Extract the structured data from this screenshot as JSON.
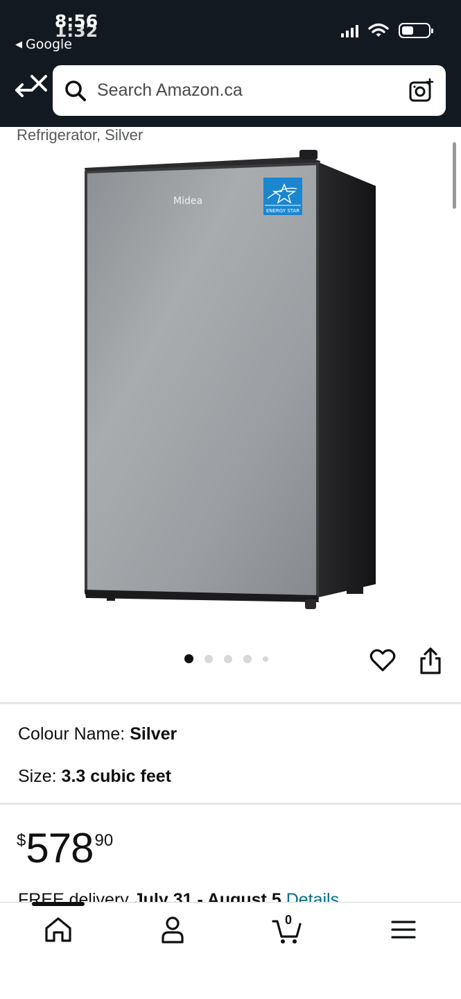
{
  "status_bar": {
    "time_primary": "8:56",
    "time_overlay": "1:32",
    "back_app_label": "Google"
  },
  "search": {
    "placeholder": "Search Amazon.ca"
  },
  "product": {
    "subtitle": "Refrigerator, Silver",
    "image_brand_text": "Midea",
    "image_badge_text": "ENERGY STAR",
    "image_count": 5,
    "active_image_index": 0
  },
  "variants": {
    "colour_label": "Colour Name:",
    "colour_value": "Silver",
    "size_label": "Size:",
    "size_value": "3.3 cubic feet"
  },
  "price": {
    "currency_symbol": "$",
    "whole": "578",
    "fraction": "90"
  },
  "delivery": {
    "prefix": "FREE delivery",
    "dates": "July 31 - August 5",
    "link": "Details"
  },
  "bottom_nav": {
    "cart_count": "0"
  },
  "colors": {
    "header_bg": "#131921",
    "link": "#007185",
    "energy_star_blue": "#1a86d0"
  }
}
